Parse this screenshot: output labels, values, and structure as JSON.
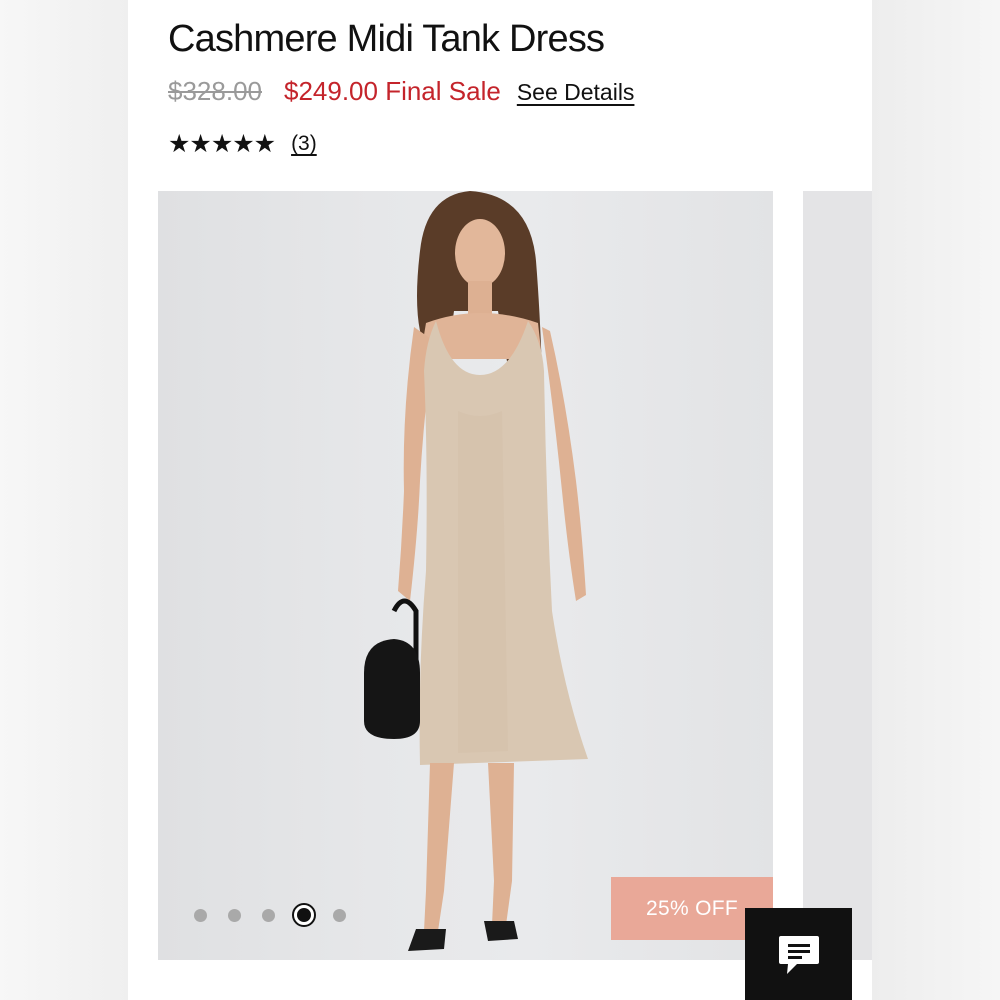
{
  "product": {
    "title": "Cashmere Midi Tank Dress",
    "original_price": "$328.00",
    "sale_price": "$249.00 Final Sale",
    "details_link": "See Details",
    "rating": {
      "stars_text": "★★★★★",
      "stars_value": 5,
      "review_count": "(3)"
    }
  },
  "gallery": {
    "badge": "25% OFF",
    "slide_count": 5,
    "active_slide": 4,
    "image_subject": "model wearing beige cashmere midi tank dress holding black handbag"
  },
  "chat": {
    "icon": "chat-bubble-icon"
  },
  "colors": {
    "sale_red": "#c4242b",
    "badge_pink": "#e9a898",
    "dress_beige": "#d9c7b2",
    "chat_black": "#111111"
  }
}
